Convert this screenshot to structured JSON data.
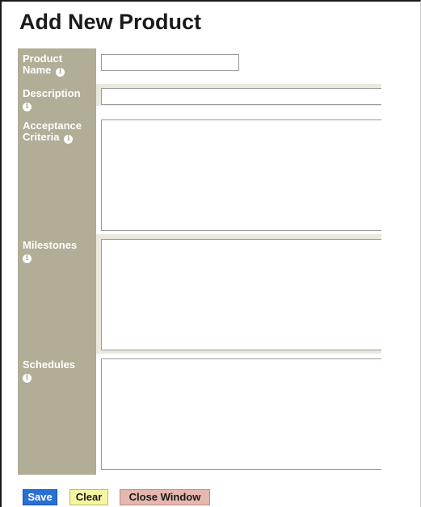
{
  "page": {
    "title": "Add New Product"
  },
  "fields": {
    "product_name": {
      "label_line1": "Product",
      "label_line2": "Name",
      "value": ""
    },
    "description": {
      "label_line1": "Description",
      "value": ""
    },
    "acceptance_criteria": {
      "label_line1": "Acceptance",
      "label_line2": "Criteria",
      "value": ""
    },
    "milestones": {
      "label_line1": "Milestones",
      "value": ""
    },
    "schedules": {
      "label_line1": "Schedules",
      "value": ""
    }
  },
  "buttons": {
    "save": "Save",
    "clear": "Clear",
    "close_window": "Close Window"
  },
  "icons": {
    "info": "i"
  },
  "colors": {
    "label_column": "#b1ad96",
    "save": "#2b6fd3",
    "clear": "#f6f6a2",
    "close_window": "#e6b7ae"
  }
}
